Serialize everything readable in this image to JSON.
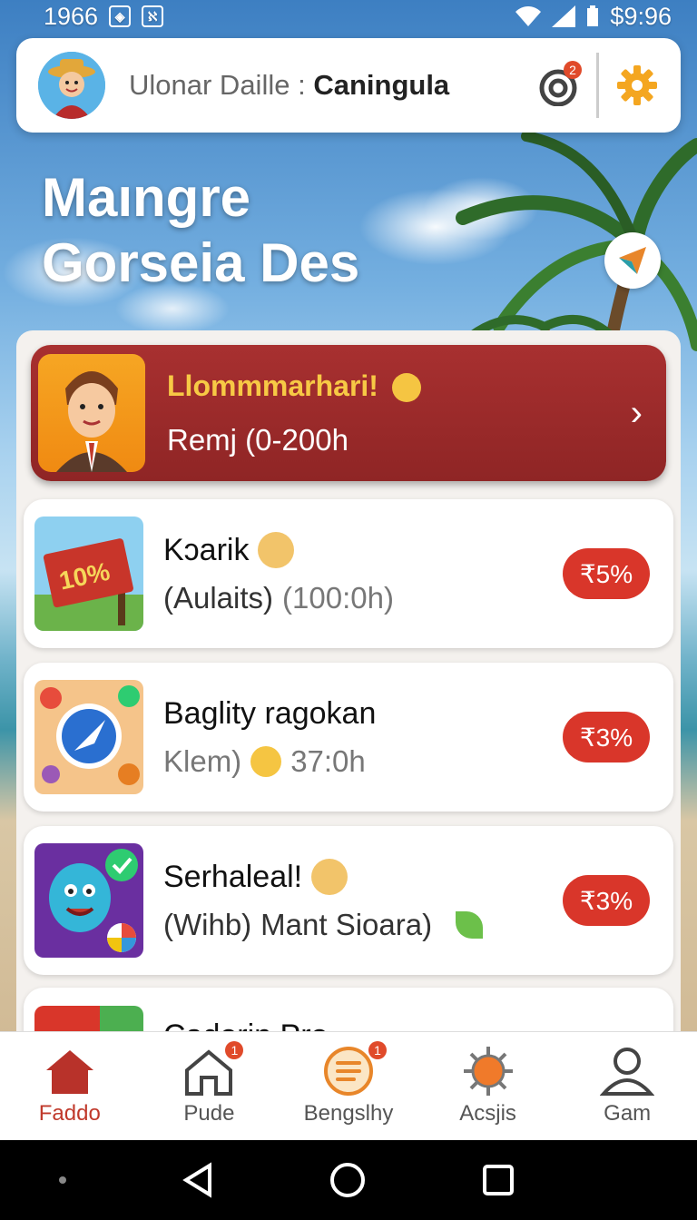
{
  "status_bar": {
    "time": "1966",
    "battery": "$9:96"
  },
  "header": {
    "title_prefix": "Ulonar Daille :",
    "title_bold": "Caningula",
    "notification_count": "2"
  },
  "hero": {
    "line1": "Maıngre",
    "line2": "Gorseia Des"
  },
  "featured": {
    "title": "Llommmarhari!",
    "subtitle": "Remj (0-200h",
    "chevron": "›"
  },
  "cards": [
    {
      "title": "Kɔarik",
      "sub_prefix": "(Aulaits)",
      "sub_muted": "(100:0h)",
      "pill": "₹5%",
      "img_text": "10%"
    },
    {
      "title": "Baglity ragokan",
      "sub_prefix": "Klem)",
      "sub_muted": "37:0h",
      "pill": "₹3%"
    },
    {
      "title": "Serhaleal!",
      "sub_prefix": "(Wihb)",
      "sub_muted": "Mant Sioara)",
      "pill": "₹3%"
    },
    {
      "title": "Cadorin Pro"
    }
  ],
  "bottom_nav": [
    {
      "label": "Faddo",
      "badge": ""
    },
    {
      "label": "Pude",
      "badge": "1"
    },
    {
      "label": "Bengslhy",
      "badge": "1"
    },
    {
      "label": "Acsjis",
      "badge": ""
    },
    {
      "label": "Gam",
      "badge": ""
    }
  ],
  "colors": {
    "accent": "#c0392b",
    "featured_bg": "#9b2a2a",
    "featured_title": "#f7c945",
    "pill": "#d9362a"
  }
}
